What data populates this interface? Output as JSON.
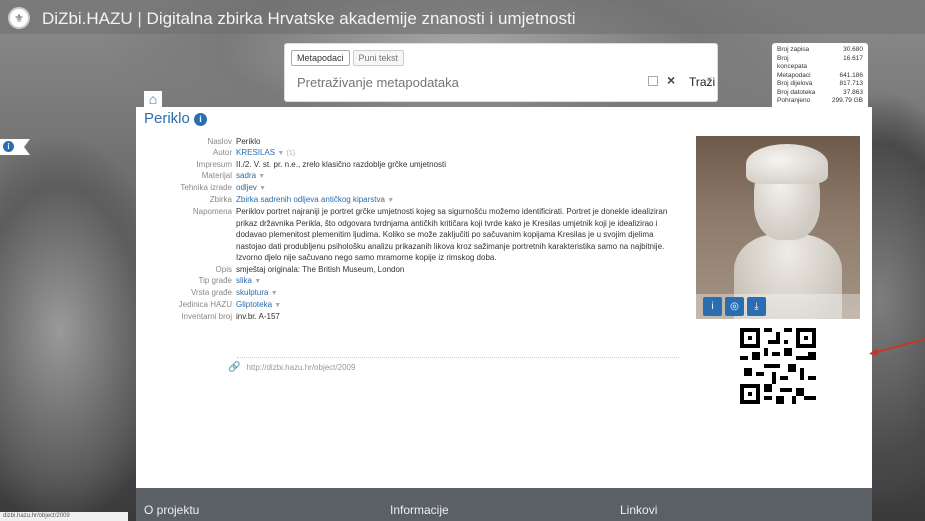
{
  "header": {
    "title": "DiZbi.HAZU",
    "separator": " | ",
    "subtitle": "Digitalna zbirka Hrvatske akademije znanosti i umjetnosti"
  },
  "search": {
    "tabs": [
      "Metapodaci",
      "Puni tekst"
    ],
    "placeholder": "Pretraživanje metapodataka",
    "clear_label": "×",
    "submit_label": "Traži"
  },
  "stats": [
    {
      "label": "Broj zapisa",
      "value": "30.680"
    },
    {
      "label": "Broj koncepata",
      "value": "16.617"
    },
    {
      "label": "Metapodaci",
      "value": "641.186"
    },
    {
      "label": "Broj dijelova",
      "value": "817.713"
    },
    {
      "label": "Broj datoteka",
      "value": "37.863"
    },
    {
      "label": "Pohranjeno",
      "value": "299.79 GB"
    }
  ],
  "page": {
    "title": "Periklo",
    "info_glyph": "i"
  },
  "fields": {
    "naslov": {
      "label": "Naslov",
      "value": "Periklo"
    },
    "autor": {
      "label": "Autor",
      "value": "KRESILAS",
      "extra": "(1)"
    },
    "impresum": {
      "label": "Impresum",
      "value": "II./2. V. st. pr. n.e., zrelo klasično razdoblje grčke umjetnosti"
    },
    "materijal": {
      "label": "Materijal",
      "value": "sadra"
    },
    "tehnika": {
      "label": "Tehnika izrade",
      "value": "odljev"
    },
    "zbirka": {
      "label": "Zbirka",
      "value": "Zbirka sadrenih odljeva antičkog kiparstva"
    },
    "napomena": {
      "label": "Napomena",
      "value": "Periklov portret najraniji je portret grčke umjetnosti kojeg sa sigurnošću možemo identificirati. Portret je donekle idealiziran prikaz državnika Perikla, što odgovara tvrdnjama antičkih kritičara koji tvrde kako je Kresilas umjetnik koji je idealizirao i dodavao plemenitost plemenitim ljudima. Koliko se može zaključiti po sačuvanim kopijama Kresilas je u svojim djelima nastojao dati produbljenu psihološku analizu prikazanih likova kroz sažimanje portretnih karakteristika samo na najbitnije. Izvorno djelo nije sačuvano nego samo mramorne kopije iz rimskog doba."
    },
    "opis": {
      "label": "Opis",
      "value": "smještaj originala: The British Museum, London"
    },
    "tip": {
      "label": "Tip građe",
      "value": "slika"
    },
    "vrsta": {
      "label": "Vrsta građe",
      "value": "skulptura"
    },
    "jedinica": {
      "label": "Jedinica HAZU",
      "value": "Gliptoteka"
    },
    "inventarni": {
      "label": "Inventarni broj",
      "value": "inv.br. A-157"
    }
  },
  "permalink": "http://dizbi.hazu.hr/object/2009",
  "footer": {
    "col1": "O projektu",
    "col2": "Informacije",
    "col3": "Linkovi"
  },
  "corner_url": "dizbi.hazu.hr/object/2009",
  "colors": {
    "accent": "#2a6db0",
    "footer": "#5b6066"
  }
}
